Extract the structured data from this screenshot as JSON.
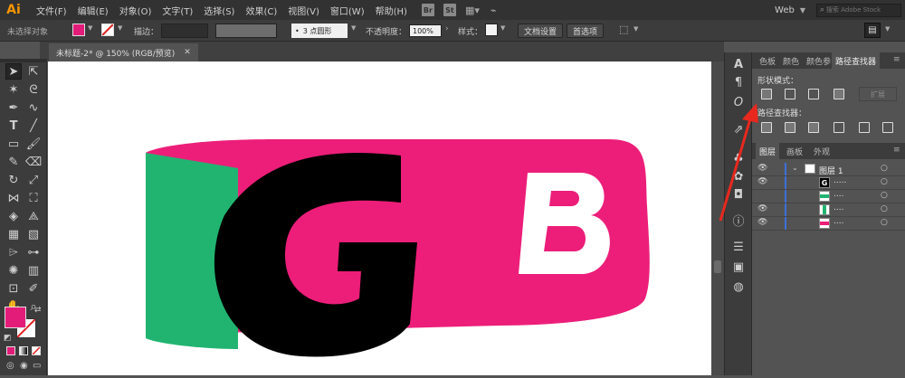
{
  "app": {
    "logo": "Ai"
  },
  "menu": {
    "items": [
      "文件(F)",
      "编辑(E)",
      "对象(O)",
      "文字(T)",
      "选择(S)",
      "效果(C)",
      "视图(V)",
      "窗口(W)",
      "帮助(H)"
    ]
  },
  "app_icons": [
    "Br",
    "St"
  ],
  "workspace": {
    "label": "Web",
    "search_placeholder": "搜索 Adobe Stock"
  },
  "controlbar": {
    "selection": "未选择对象",
    "stroke_label": "描边：",
    "brush": "3 点圆形",
    "opacity_label": "不透明度：",
    "opacity_value": "100%",
    "style_label": "样式：",
    "doc_setup": "文档设置",
    "preferences": "首选项"
  },
  "document": {
    "tab": "未标题-2* @ 150% (RGB/预览)"
  },
  "colors": {
    "fill": "#e31c79",
    "pink": "#ec1e79",
    "green": "#21b471",
    "black": "#000000"
  },
  "artwork": {
    "letters": [
      "G",
      "B"
    ]
  },
  "pathfinder_panel": {
    "tabs": [
      "色板",
      "颜色",
      "颜色参",
      "路径查找器"
    ],
    "shape_modes_label": "形状模式：",
    "expand_label": "扩展",
    "pathfinders_label": "路径查找器："
  },
  "layers_panel": {
    "tabs": [
      "图层",
      "画板",
      "外观"
    ],
    "layer_name": "图层 1",
    "sublayers": [
      ".....",
      "....",
      "....",
      "...."
    ]
  }
}
